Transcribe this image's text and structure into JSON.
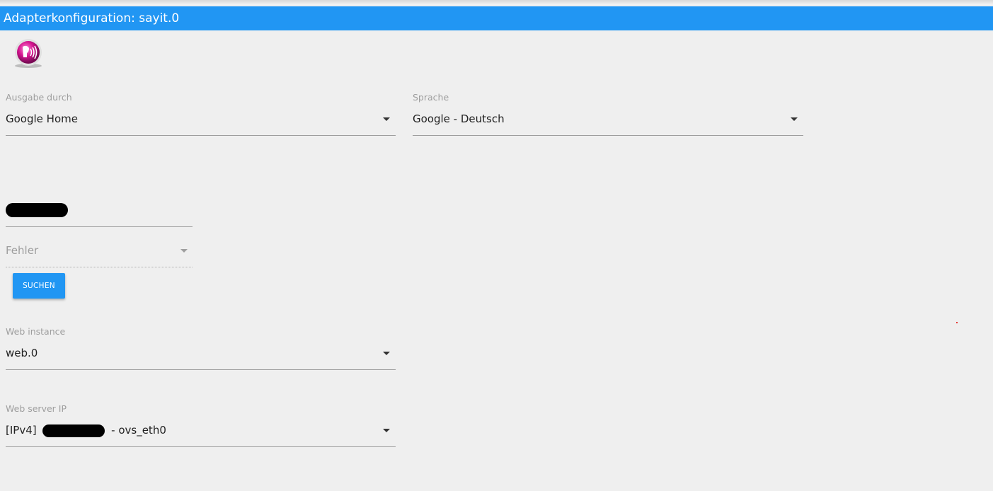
{
  "window": {
    "title": "Adapterkonfiguration: sayit.0"
  },
  "form": {
    "ausgabe": {
      "label": "Ausgabe durch",
      "value": "Google Home"
    },
    "sprache": {
      "label": "Sprache",
      "value": "Google - Deutsch"
    },
    "device": {
      "label": "",
      "value": ""
    },
    "fehler": {
      "value": "Fehler"
    },
    "suchen_button": "SUCHEN",
    "web_instance": {
      "label": "Web instance",
      "value": "web.0"
    },
    "web_server_ip": {
      "label": "Web server IP",
      "value_prefix": "[IPv4]",
      "value_suffix": "- ovs_eth0"
    }
  },
  "colors": {
    "accent": "#2196f3",
    "background": "#efefef"
  },
  "icons": {
    "logo": "sayit-speaker-icon",
    "dropdown": "chevron-down-icon"
  }
}
